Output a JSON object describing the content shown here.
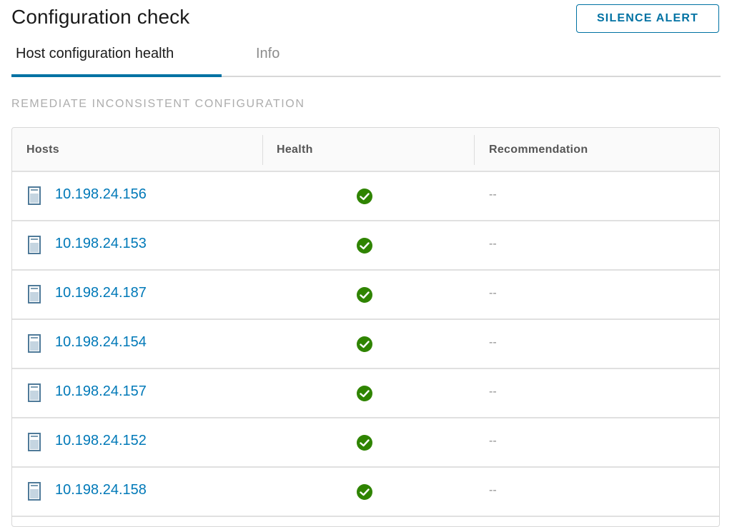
{
  "header": {
    "title": "Configuration check",
    "silence_button_label": "SILENCE ALERT"
  },
  "tabs": [
    {
      "label": "Host configuration health",
      "active": true
    },
    {
      "label": "Info",
      "active": false
    }
  ],
  "section": {
    "label": "REMEDIATE INCONSISTENT CONFIGURATION"
  },
  "table": {
    "columns": [
      "Hosts",
      "Health",
      "Recommendation"
    ],
    "rows": [
      {
        "host": "10.198.24.156",
        "health": "healthy",
        "health_icon": "check-circle-icon",
        "recommendation": "--"
      },
      {
        "host": "10.198.24.153",
        "health": "healthy",
        "health_icon": "check-circle-icon",
        "recommendation": "--"
      },
      {
        "host": "10.198.24.187",
        "health": "healthy",
        "health_icon": "check-circle-icon",
        "recommendation": "--"
      },
      {
        "host": "10.198.24.154",
        "health": "healthy",
        "health_icon": "check-circle-icon",
        "recommendation": "--"
      },
      {
        "host": "10.198.24.157",
        "health": "healthy",
        "health_icon": "check-circle-icon",
        "recommendation": "--"
      },
      {
        "host": "10.198.24.152",
        "health": "healthy",
        "health_icon": "check-circle-icon",
        "recommendation": "--"
      },
      {
        "host": "10.198.24.158",
        "health": "healthy",
        "health_icon": "check-circle-icon",
        "recommendation": "--"
      }
    ]
  },
  "colors": {
    "accent": "#0072a3",
    "link": "#0079b8",
    "success": "#2f8400"
  }
}
